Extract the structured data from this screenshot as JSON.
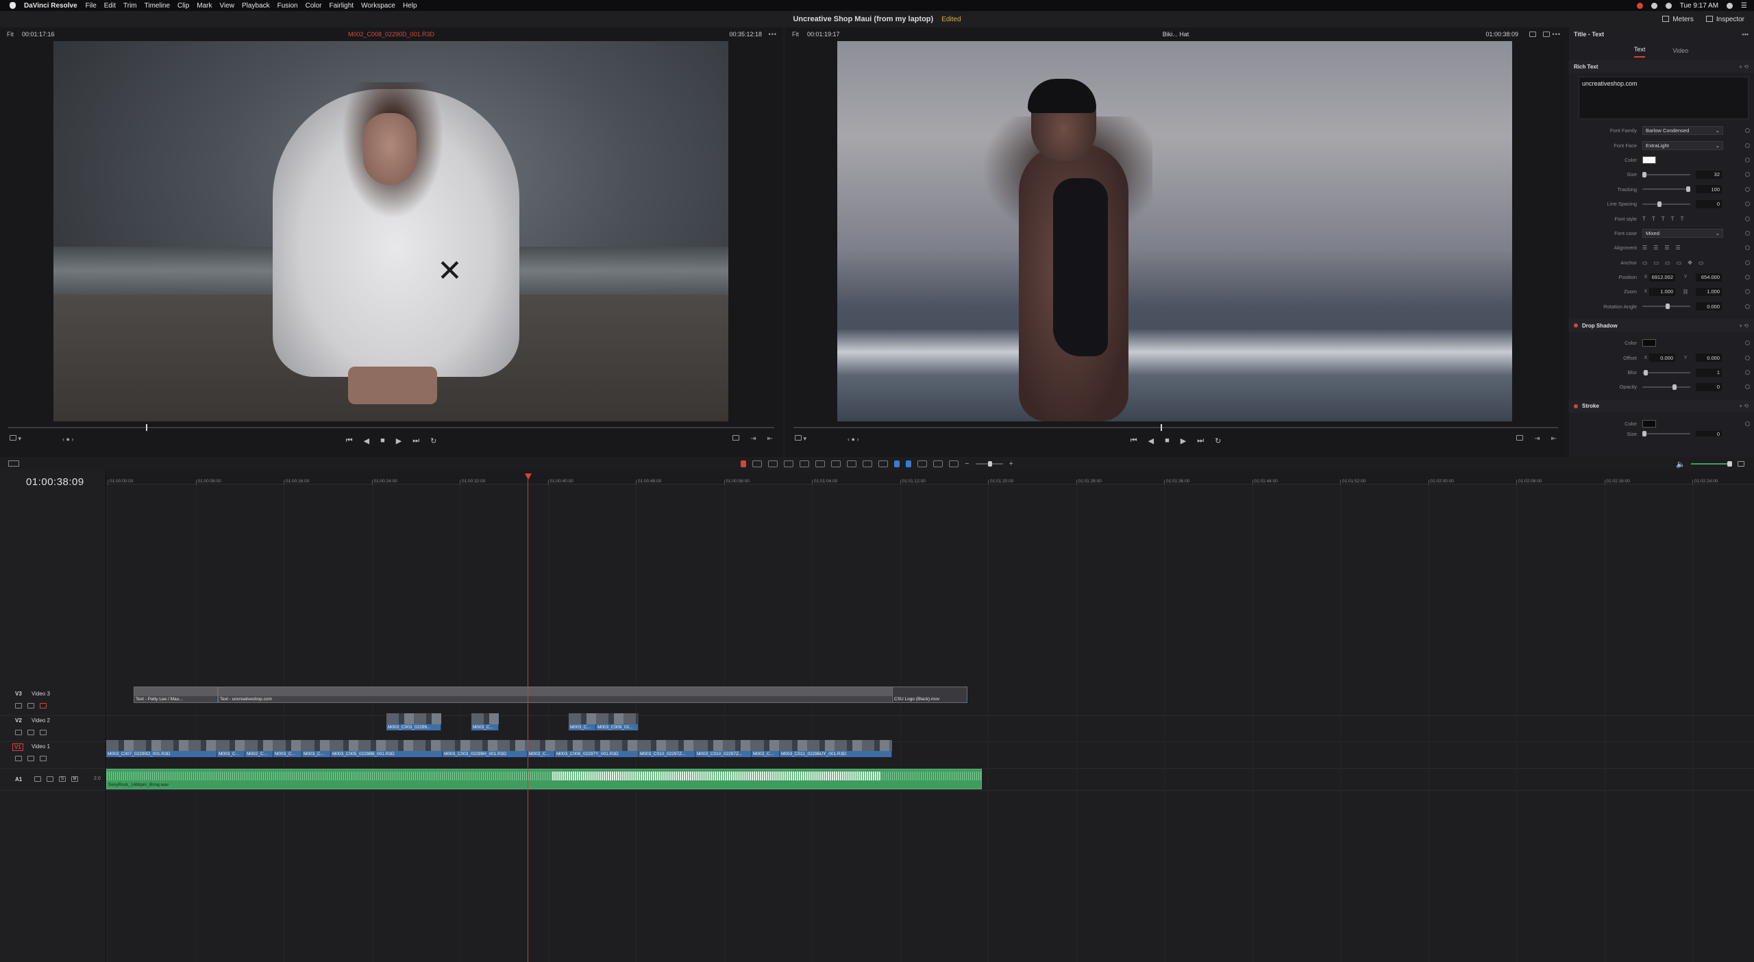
{
  "os_menu": {
    "app_name": "DaVinci Resolve",
    "items": [
      "File",
      "Edit",
      "Trim",
      "Timeline",
      "Clip",
      "Mark",
      "View",
      "Playback",
      "Fusion",
      "Color",
      "Fairlight",
      "Workspace",
      "Help"
    ],
    "clock": "Tue 9:17 AM"
  },
  "title_bar": {
    "project": "Uncreative Shop Maui (from my laptop)",
    "status": "Edited",
    "meters_label": "Meters",
    "inspector_label": "Inspector"
  },
  "source_viewer": {
    "fit": "Fit",
    "timecode_left": "00:01:17:16",
    "clip_name": "M002_C008_02290D_001.R3D",
    "timecode_right": "00:35:12:18",
    "playhead_fraction": 0.18
  },
  "program_viewer": {
    "fit": "Fit",
    "timecode_left": "00:01:19:17",
    "clip_name": "Biki... Hat",
    "timecode_right": "01:00:38:09",
    "playhead_fraction": 0.48
  },
  "inspector": {
    "title": "Title - Text",
    "tabs": [
      "Text",
      "Video"
    ],
    "active_tab": "Text",
    "rich_text_section": "Rich Text",
    "rich_text_value": "uncreativeshop.com",
    "font_family_label": "Font Family",
    "font_family": "Barlow Condensed",
    "font_face_label": "Font Face",
    "font_face": "ExtraLight",
    "color_label": "Color",
    "size_label": "Size",
    "size": "32",
    "tracking_label": "Tracking",
    "tracking": "100",
    "line_spacing_label": "Line Spacing",
    "line_spacing": "0",
    "font_style_label": "Font style",
    "font_style_glyphs": [
      "T",
      "T",
      "T",
      "T",
      "T"
    ],
    "font_case_label": "Font case",
    "font_case": "Mixed",
    "alignment_label": "Alignment",
    "anchor_label": "Anchor",
    "position_label": "Position",
    "position_x": "6912.002",
    "position_y": "654.000",
    "zoom_label": "Zoom",
    "zoom_x": "1.000",
    "zoom_y": "1.000",
    "rotation_label": "Rotation Angle",
    "rotation": "0.000",
    "drop_shadow_section": "Drop Shadow",
    "shadow_color_label": "Color",
    "offset_label": "Offset",
    "offset_x": "0.000",
    "offset_y": "0.000",
    "blur_label": "Blur",
    "blur": "1",
    "opacity_label": "Opacity",
    "opacity": "0",
    "stroke_section": "Stroke",
    "stroke_color_label": "Color",
    "stroke_size_label": "Size",
    "stroke_size": "0",
    "x_label": "X",
    "y_label": "Y"
  },
  "timeline": {
    "current_timecode": "01:00:38:09",
    "ruler_labels": [
      "01:00:00:00",
      "01:00:08:00",
      "01:00:16:00",
      "01:00:24:00",
      "01:00:32:00",
      "01:00:40:00",
      "01:00:48:00",
      "01:00:56:00",
      "01:01:04:00",
      "01:01:12:00",
      "01:01:20:00",
      "01:01:28:00",
      "01:01:36:00",
      "01:01:44:00",
      "01:01:52:00",
      "01:02:00:00",
      "01:02:08:00",
      "01:02:16:00",
      "01:02:24:00"
    ],
    "tracks": {
      "v3": {
        "id": "V3",
        "name": "Video 3"
      },
      "v2": {
        "id": "V2",
        "name": "Video 2"
      },
      "v1": {
        "id": "V1",
        "name": "Video 1"
      },
      "a1": {
        "id": "A1",
        "level": "2.0"
      }
    },
    "v3_clips": {
      "title1": "Text - Patty Lee / Mau...",
      "title2": "Text - uncreativeshop.com",
      "logo": "CSU Logo (Black).mov"
    },
    "v2_clips": {
      "c1": "M003_C003_02299...",
      "c2": "M003_C...",
      "c3": "M003_C...",
      "c4": "M003_C009_02..."
    },
    "v1_clips": {
      "c1": "M003_C007_02290O_001.R3D",
      "c2": "M003_C...",
      "c3": "M002_C...",
      "c4": "M003_C...",
      "c5": "M003_C...",
      "c6": "M003_C005_02298B_001.R3D",
      "c7": "M003_C003_02299H_001.R3D",
      "c8": "M003_C...",
      "c9": "M003_C006_02297Y_001.R3D",
      "c10": "M003_C010_02297Z...",
      "c11": "M003_C010_02297Z...",
      "c12": "M003_C...",
      "c13": "M003_C011_02296UY_001.R3D"
    },
    "audio_clip": "SexyRock_146bpm_Bmaj.wav",
    "solo_label": "S",
    "mute_label": "M"
  }
}
